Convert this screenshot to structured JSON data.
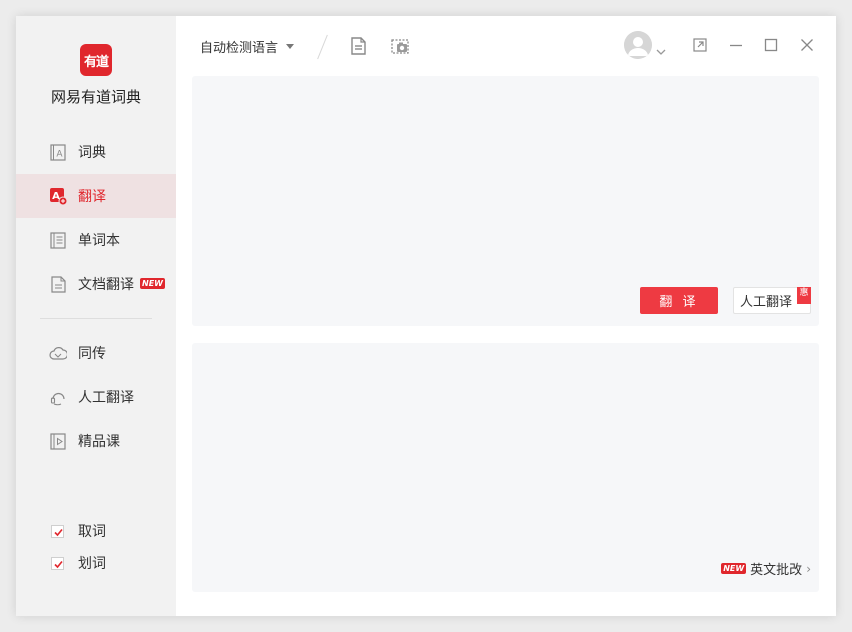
{
  "app": {
    "name": "网易有道词典",
    "logo_text": "有道"
  },
  "sidebar": {
    "items": [
      {
        "label": "词典",
        "active": false
      },
      {
        "label": "翻译",
        "active": true
      },
      {
        "label": "单词本",
        "active": false
      },
      {
        "label": "文档翻译",
        "active": false,
        "badge": "NEW"
      },
      {
        "label": "同传",
        "active": false
      },
      {
        "label": "人工翻译",
        "active": false
      },
      {
        "label": "精品课",
        "active": false
      }
    ],
    "checks": [
      {
        "label": "取词",
        "checked": true
      },
      {
        "label": "划词",
        "checked": true
      }
    ]
  },
  "toolbar": {
    "language": "自动检测语言"
  },
  "input": {
    "translate_label": "翻 译",
    "human_label": "人工翻译",
    "human_tag": "惠"
  },
  "output": {
    "essay_badge": "NEW",
    "essay_label": "英文批改",
    "essay_arrow": "›"
  },
  "colors": {
    "accent": "#e0272d",
    "button": "#ee3a42",
    "panel": "#f6f7f9",
    "sidebar": "#f2f2f2"
  }
}
